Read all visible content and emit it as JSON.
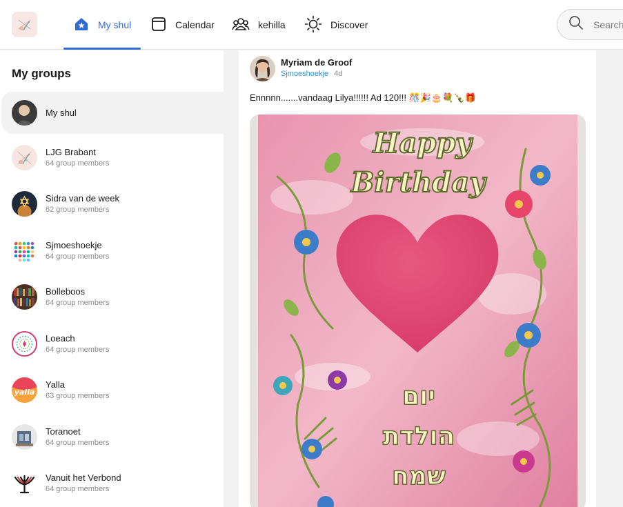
{
  "colors": {
    "accent": "#2f6bd1",
    "link": "#2f8fd1",
    "muted": "#8a8a8a"
  },
  "nav": {
    "items": [
      {
        "label": "My shul",
        "icon": "house-star-icon",
        "active": true
      },
      {
        "label": "Calendar",
        "icon": "calendar-icon",
        "active": false
      },
      {
        "label": "kehilla",
        "icon": "people-icon",
        "active": false
      },
      {
        "label": "Discover",
        "icon": "sun-icon",
        "active": false
      }
    ]
  },
  "search": {
    "placeholder": "Search"
  },
  "sidebar": {
    "title": "My groups",
    "groups": [
      {
        "name": "My shul",
        "meta": ""
      },
      {
        "name": "LJG Brabant",
        "meta": "64 group members"
      },
      {
        "name": "Sidra van de week",
        "meta": "62 group members"
      },
      {
        "name": "Sjmoeshoekje",
        "meta": "64 group members"
      },
      {
        "name": "Bolleboos",
        "meta": "64 group members"
      },
      {
        "name": "Loeach",
        "meta": "64 group members"
      },
      {
        "name": "Yalla",
        "meta": "63 group members"
      },
      {
        "name": "Toranoet",
        "meta": "64 group members"
      },
      {
        "name": "Vanuit het Verbond",
        "meta": "64 group members"
      }
    ]
  },
  "post": {
    "author": "Myriam de Groof",
    "group": "Sjmoeshoekje",
    "time": "4d",
    "text": "Ennnnn.......vandaag Lilya!!!!!! Ad 120!!! 🎊🎉🎂💐🍾🎁",
    "image": {
      "title_line1": "Happy",
      "title_line2": "Birthday",
      "hebrew_line1": "יום",
      "hebrew_line2": "הולדת",
      "hebrew_line3": "שמח"
    }
  }
}
